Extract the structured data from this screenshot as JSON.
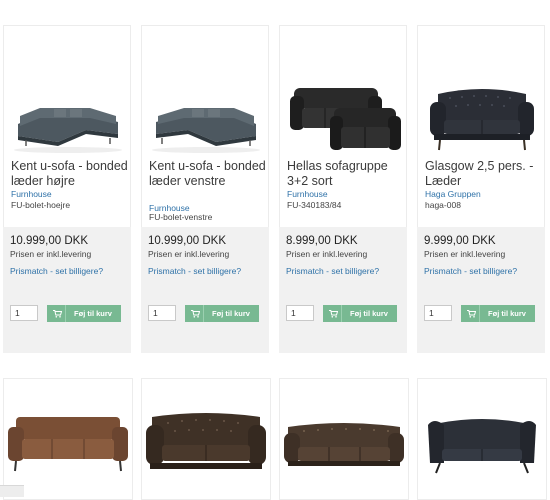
{
  "colors": {
    "brand_link": "#2f72a8",
    "button_green": "#78b992",
    "card_bottom": "#f1f1f1"
  },
  "products": [
    {
      "name": "Kent u-sofa - bonded læder højre",
      "brand": "Furnhouse",
      "sku": "FU-bolet-hoejre",
      "price": "10.999,00 DKK",
      "price_info": "Prisen er inkl.levering",
      "prismatch": "Prismatch - set billigere?",
      "qty": "1",
      "cart_label": "Føj til kurv",
      "image_icon": "u-sofa-icon"
    },
    {
      "name": "Kent u-sofa - bonded læder venstre",
      "brand": "Furnhouse",
      "sku": "FU-bolet-venstre",
      "price": "10.999,00 DKK",
      "price_info": "Prisen er inkl.levering",
      "prismatch": "Prismatch - set billigere?",
      "qty": "1",
      "cart_label": "Føj til kurv",
      "image_icon": "u-sofa-icon"
    },
    {
      "name": "Hellas sofagruppe 3+2 sort",
      "brand": "Furnhouse",
      "sku": "FU-340183/84",
      "price": "8.999,00 DKK",
      "price_info": "Prisen er inkl.levering",
      "prismatch": "Prismatch - set billigere?",
      "qty": "1",
      "cart_label": "Føj til kurv",
      "image_icon": "sofa-group-icon"
    },
    {
      "name": "Glasgow 2,5 pers. - Læder",
      "brand": "Haga Gruppen",
      "sku": "haga-008",
      "price": "9.999,00 DKK",
      "price_info": "Prisen er inkl.levering",
      "prismatch": "Prismatch - set billigere?",
      "qty": "1",
      "cart_label": "Føj til kurv",
      "image_icon": "tufted-sofa-icon"
    }
  ],
  "second_row": [
    {
      "image_icon": "brown-leather-sofa-icon"
    },
    {
      "image_icon": "chesterfield-sofa-icon"
    },
    {
      "image_icon": "chesterfield-sofa-icon"
    },
    {
      "image_icon": "wing-sofa-icon"
    }
  ]
}
